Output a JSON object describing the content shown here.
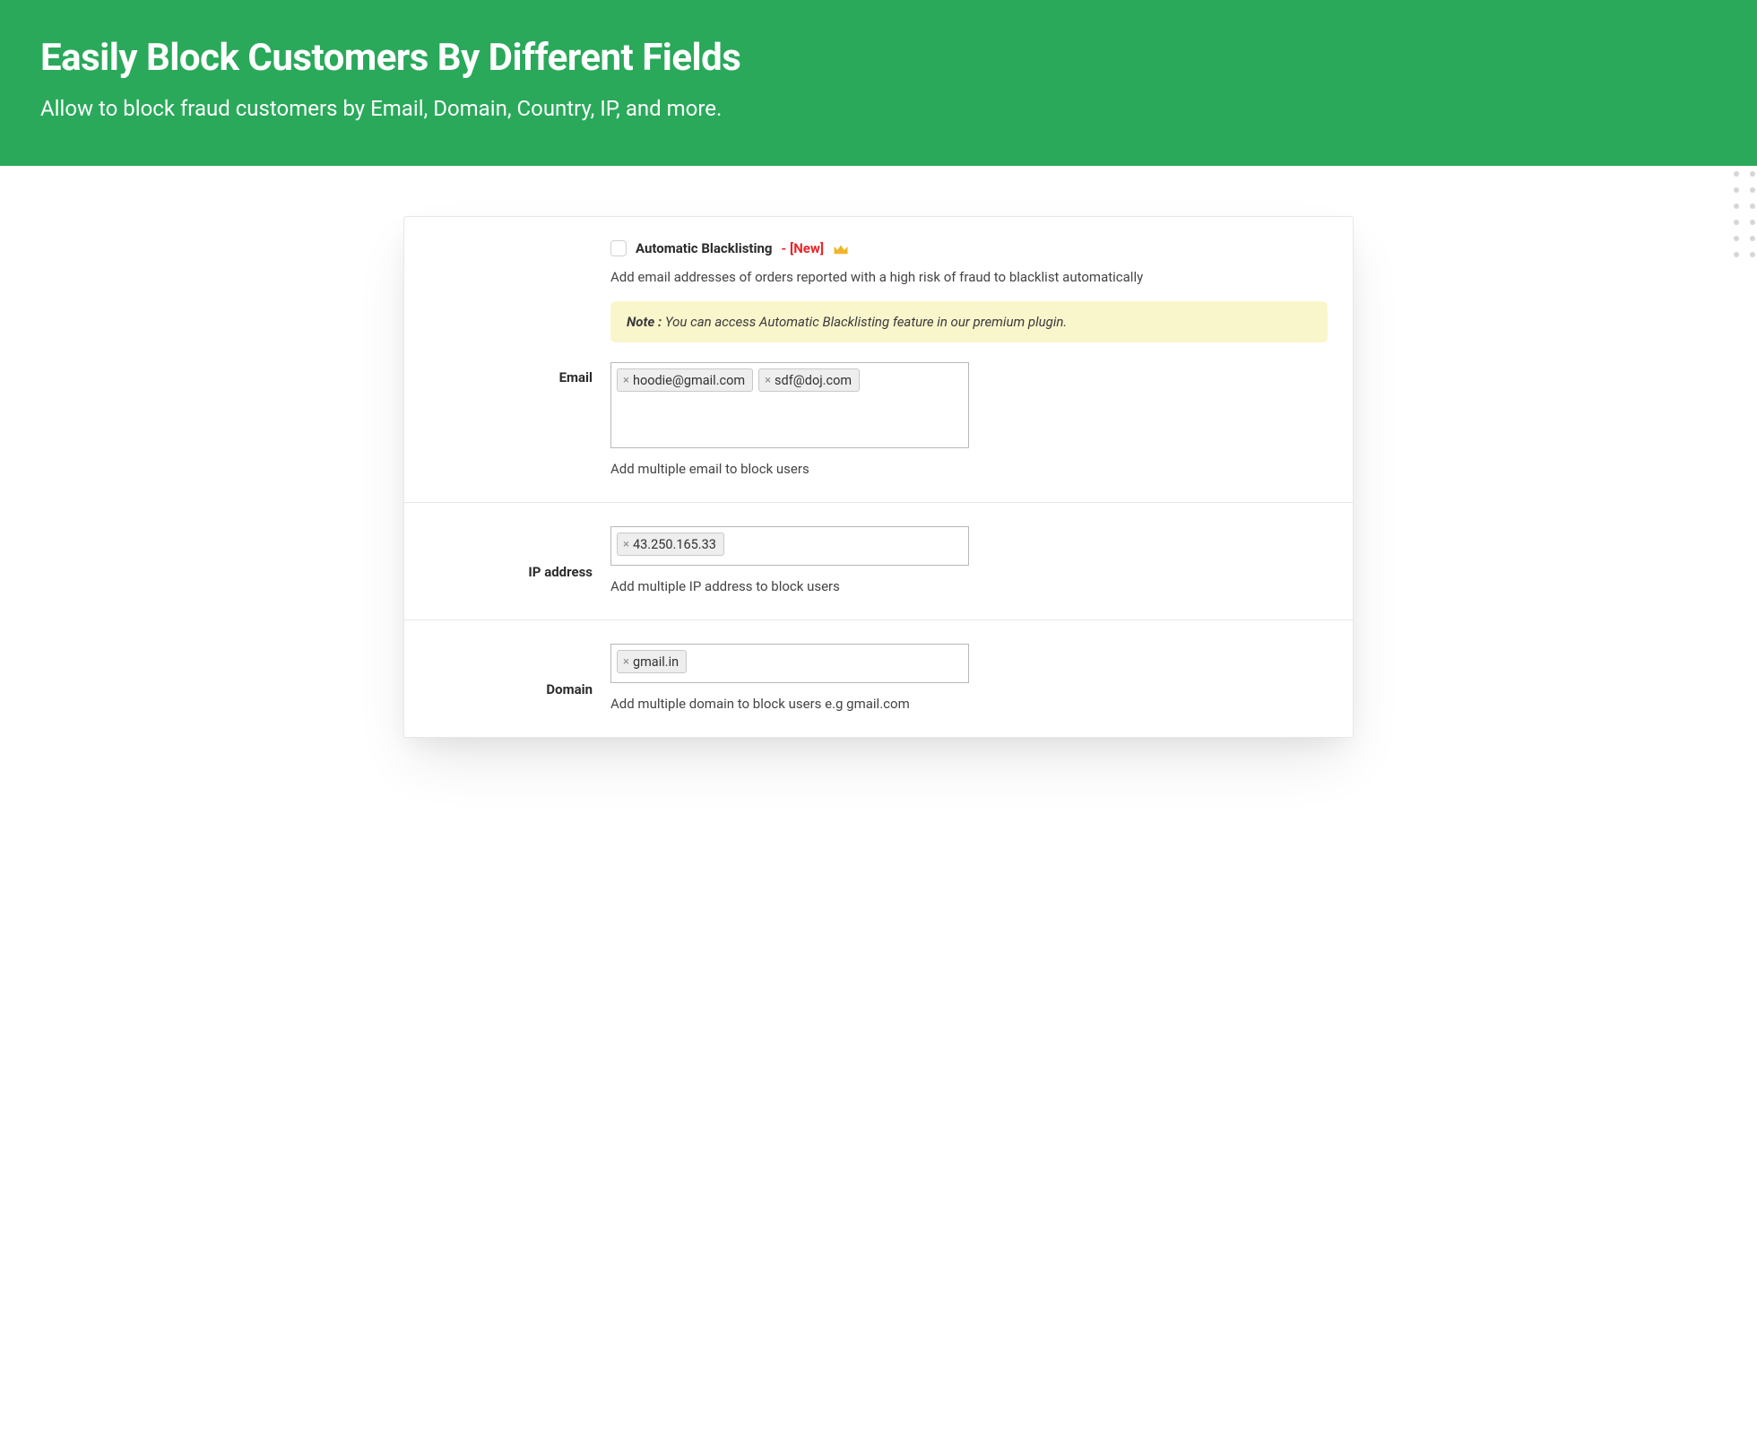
{
  "hero": {
    "title": "Easily Block Customers By Different Fields",
    "subtitle": "Allow to block fraud customers by Email, Domain, Country, IP, and more."
  },
  "autoBlacklist": {
    "checkbox_checked": false,
    "label": "Automatic Blacklisting",
    "new_tag": "- [New]",
    "crown_icon": "crown-icon",
    "description": "Add email addresses of orders reported with a high risk of fraud to blacklist automatically",
    "note_label": "Note :",
    "note_text": " You can access Automatic Blacklisting feature in our premium plugin."
  },
  "fields": {
    "email": {
      "label": "Email",
      "tags": [
        "hoodie@gmail.com",
        "sdf@doj.com"
      ],
      "helper": "Add multiple email to block users"
    },
    "ip": {
      "label": "IP address",
      "tags": [
        "43.250.165.33"
      ],
      "helper": "Add multiple IP address to block users"
    },
    "domain": {
      "label": "Domain",
      "tags": [
        "gmail.in"
      ],
      "helper": "Add multiple domain to block users e.g gmail.com"
    }
  }
}
